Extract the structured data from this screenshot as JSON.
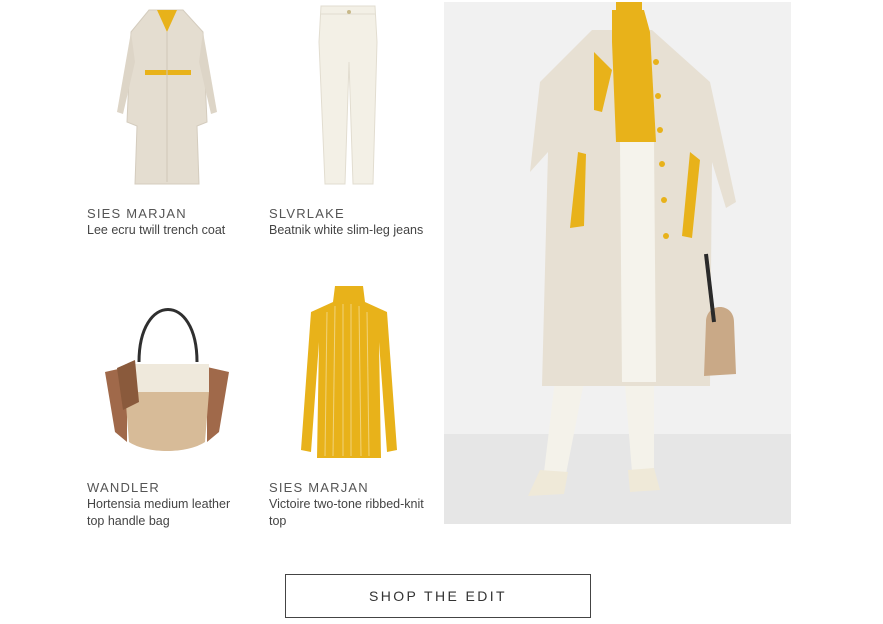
{
  "products": [
    {
      "brand": "SIES MARJAN",
      "name": "Lee ecru twill trench coat",
      "image": "trench-coat-image"
    },
    {
      "brand": "SLVRLAKE",
      "name": "Beatnik white slim-leg jeans",
      "image": "white-jeans-image"
    },
    {
      "brand": "WANDLER",
      "name": "Hortensia medium leather top handle bag",
      "image": "handle-bag-image"
    },
    {
      "brand": "SIES MARJAN",
      "name": "Victoire two-tone ribbed-knit top",
      "image": "ribbed-top-image"
    }
  ],
  "hero": {
    "image": "model-outfit-photo"
  },
  "cta": {
    "label": "SHOP THE EDIT"
  },
  "colors": {
    "accent_yellow": "#e8b21a",
    "ecru": "#e7e0d3",
    "tan": "#c9a987",
    "brown": "#8a5a3c",
    "border": "#444444"
  }
}
